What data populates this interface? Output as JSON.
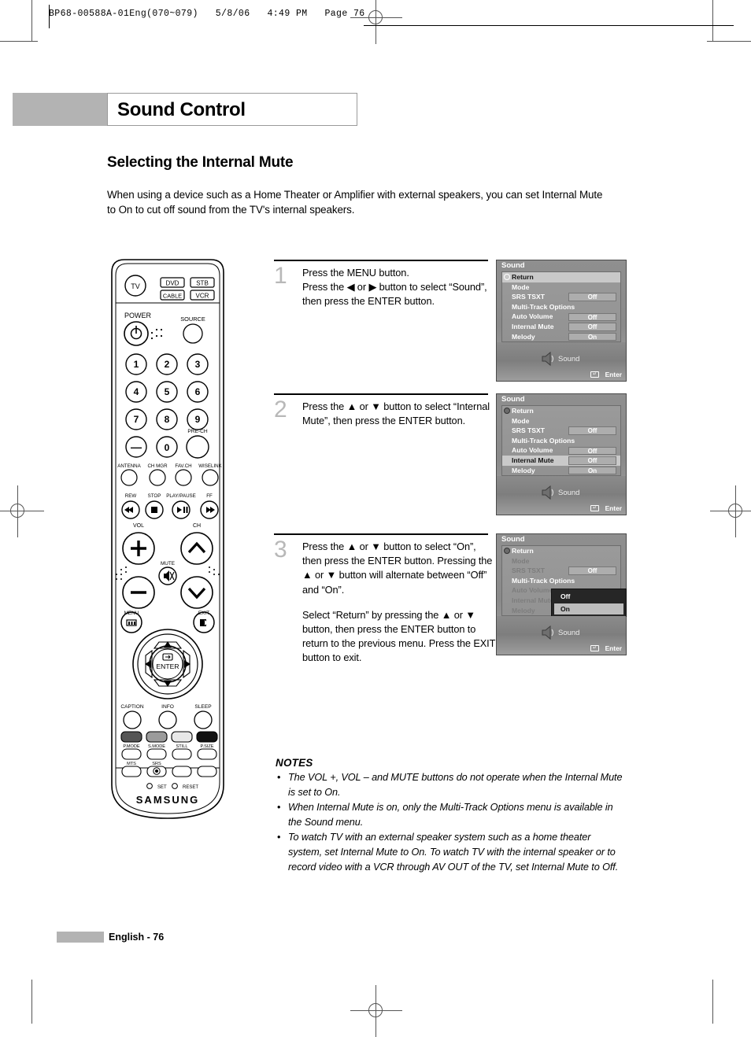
{
  "print_header": {
    "text": "BP68-00588A-01Eng(070~079)   5/8/06   4:49 PM   Page 76"
  },
  "chapter": {
    "title": "Sound Control"
  },
  "section": {
    "title": "Selecting the Internal Mute"
  },
  "intro": "When using a device such as a Home Theater or Amplifier with external speakers, you can set Internal Mute to On to cut off sound from the TV's internal speakers.",
  "steps": [
    {
      "number": "1",
      "paragraphs": [
        "Press the MENU button.\nPress the ◀ or ▶ button to select “Sound”, then press the ENTER button."
      ]
    },
    {
      "number": "2",
      "paragraphs": [
        "Press the ▲ or ▼ button to select “Internal Mute”, then press the ENTER button."
      ]
    },
    {
      "number": "3",
      "paragraphs": [
        "Press the ▲ or ▼ button to select “On”, then press the ENTER button. Pressing the ▲ or ▼ button will alternate between “Off” and “On”.",
        "Select “Return” by pressing the ▲ or ▼ button, then press the ENTER button to return to the previous menu. Press the EXIT button to exit."
      ]
    }
  ],
  "osd": {
    "title": "Sound",
    "return_label": "Return",
    "footer_caption": "Sound",
    "enter_label": "Enter",
    "screens": [
      {
        "id": "screen-1",
        "rows": [
          {
            "label": "Mode",
            "value": null,
            "dim": false,
            "highlight": false
          },
          {
            "label": "SRS TSXT",
            "value": "Off",
            "dim": false,
            "highlight": false
          },
          {
            "label": "Multi-Track Options",
            "value": null,
            "dim": false,
            "highlight": false
          },
          {
            "label": "Auto Volume",
            "value": "Off",
            "dim": false,
            "highlight": false
          },
          {
            "label": "Internal Mute",
            "value": "Off",
            "dim": false,
            "highlight": false
          },
          {
            "label": "Melody",
            "value": "On",
            "dim": false,
            "highlight": false
          }
        ],
        "return_highlighted": true,
        "dropdown": null
      },
      {
        "id": "screen-2",
        "rows": [
          {
            "label": "Mode",
            "value": null,
            "dim": false,
            "highlight": false
          },
          {
            "label": "SRS TSXT",
            "value": "Off",
            "dim": false,
            "highlight": false
          },
          {
            "label": "Multi-Track Options",
            "value": null,
            "dim": false,
            "highlight": false
          },
          {
            "label": "Auto Volume",
            "value": "Off",
            "dim": false,
            "highlight": false
          },
          {
            "label": "Internal Mute",
            "value": "Off",
            "dim": false,
            "highlight": true
          },
          {
            "label": "Melody",
            "value": "On",
            "dim": false,
            "highlight": false
          }
        ],
        "return_highlighted": false,
        "dropdown": null
      },
      {
        "id": "screen-3",
        "rows": [
          {
            "label": "Mode",
            "value": null,
            "dim": true,
            "highlight": false
          },
          {
            "label": "SRS TSXT",
            "value": "Off",
            "dim": true,
            "highlight": false
          },
          {
            "label": "Multi-Track Options",
            "value": null,
            "dim": false,
            "highlight": false
          },
          {
            "label": "Auto Volume",
            "value": null,
            "dim": true,
            "highlight": false
          },
          {
            "label": "Internal Mute",
            "value": null,
            "dim": true,
            "highlight": false
          },
          {
            "label": "Melody",
            "value": null,
            "dim": true,
            "highlight": false
          }
        ],
        "return_highlighted": false,
        "dropdown": {
          "options": [
            "Off",
            "On"
          ],
          "selected": "On"
        }
      }
    ]
  },
  "remote": {
    "brand": "SAMSUNG",
    "device_buttons": [
      "TV",
      "DVD",
      "STB",
      "CABLE",
      "VCR"
    ],
    "power_label": "POWER",
    "source_label": "SOURCE",
    "keypad": [
      "1",
      "2",
      "3",
      "4",
      "5",
      "6",
      "7",
      "8",
      "9",
      "—",
      "0"
    ],
    "prech_label": "PRE-CH",
    "function_row": [
      "ANTENNA",
      "CH MGR",
      "FAV.CH",
      "WISELINK"
    ],
    "transport": [
      "REW",
      "STOP",
      "PLAY/PAUSE",
      "FF"
    ],
    "vol_label": "VOL",
    "ch_label": "CH",
    "mute_label": "MUTE",
    "menu_label": "MENU",
    "exit_label": "EXIT",
    "enter_label": "ENTER",
    "bottom_row": [
      "CAPTION",
      "INFO",
      "SLEEP"
    ],
    "mode_row": [
      "P.MODE",
      "S.MODE",
      "STILL",
      "P.SIZE"
    ],
    "mts_label": "MTS",
    "srs_label": "SRS",
    "set_label": "SET",
    "reset_label": "RESET"
  },
  "notes": {
    "heading": "NOTES",
    "items": [
      "The VOL +, VOL – and MUTE buttons do not operate when the Internal Mute is set to On.",
      "When Internal Mute is on, only the Multi-Track Options menu is available in the Sound menu.",
      "To watch TV with an external speaker system such as a home theater system, set Internal Mute to On. To watch TV with the internal speaker or to record video with a VCR through AV OUT of the TV, set Internal Mute to Off."
    ]
  },
  "page_footer": {
    "label": "English - 76"
  }
}
